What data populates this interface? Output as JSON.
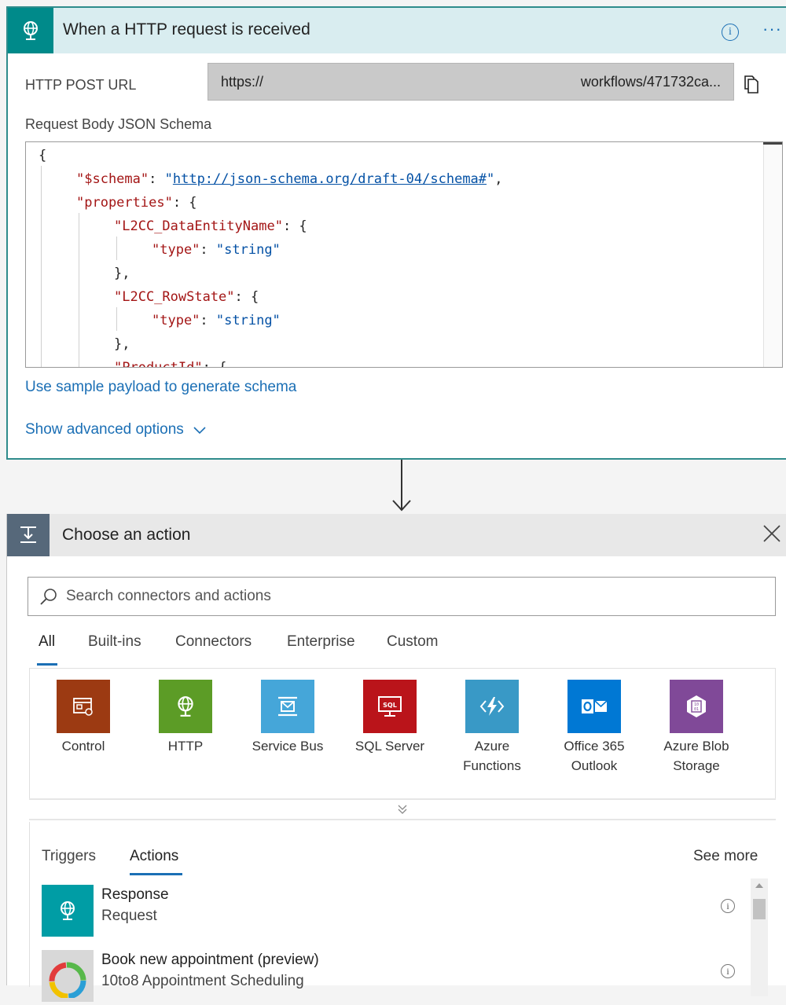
{
  "colors": {
    "trigger_accent": "#008a8a",
    "link": "#1b6fb5",
    "action_header_icon": "#56687a"
  },
  "trigger": {
    "title": "When a HTTP request is received",
    "info_icon": "i",
    "more_icon": "···",
    "http_post_url_label": "HTTP POST URL",
    "url_start": "https://",
    "url_end": "workflows/471732ca...",
    "schema_label": "Request Body JSON Schema",
    "schema_lines": {
      "l0": "{",
      "l1_key": "\"$schema\"",
      "l1_colon": ": ",
      "l1_q1": "\"",
      "l1_url": "http://json-schema.org/draft-04/schema#",
      "l1_q2": "\"",
      "l1_comma": ",",
      "l2_key": "\"properties\"",
      "l2_rest": ": {",
      "l3_key": "\"L2CC_DataEntityName\"",
      "l3_rest": ": {",
      "l4_key": "\"type\"",
      "l4_colon": ": ",
      "l4_val": "\"string\"",
      "l5": "},",
      "l6_key": "\"L2CC_RowState\"",
      "l6_rest": ": {",
      "l7_key": "\"type\"",
      "l7_colon": ": ",
      "l7_val": "\"string\"",
      "l8": "},",
      "l9_key": "\"ProductId\"",
      "l9_rest": ": {"
    },
    "sample_payload_link": "Use sample payload to generate schema",
    "advanced_options_link": "Show advanced options"
  },
  "action_picker": {
    "title": "Choose an action",
    "search_placeholder": "Search connectors and actions",
    "tabs": [
      "All",
      "Built-ins",
      "Connectors",
      "Enterprise",
      "Custom"
    ],
    "active_tab": "All",
    "connectors": [
      {
        "line1": "Control",
        "line2": "",
        "icon": "control-icon",
        "color": "#9c3a12"
      },
      {
        "line1": "HTTP",
        "line2": "",
        "icon": "globe-icon",
        "color": "#5c9c26"
      },
      {
        "line1": "Service Bus",
        "line2": "",
        "icon": "service-bus-icon",
        "color": "#45a6d9"
      },
      {
        "line1": "SQL Server",
        "line2": "",
        "icon": "sql-icon",
        "color": "#ba141a"
      },
      {
        "line1": "Azure",
        "line2": "Functions",
        "icon": "lightning-icon",
        "color": "#3999c6"
      },
      {
        "line1": "Office 365",
        "line2": "Outlook",
        "icon": "outlook-icon",
        "color": "#0078d4"
      },
      {
        "line1": "Azure Blob",
        "line2": "Storage",
        "icon": "blob-icon",
        "color": "#804998"
      }
    ],
    "subtabs": [
      "Triggers",
      "Actions"
    ],
    "active_subtab": "Actions",
    "see_more": "See more",
    "items": [
      {
        "title": "Response",
        "subtitle": "Request",
        "icon": "globe-icon",
        "color": "#009da5"
      },
      {
        "title": "Book new appointment (preview)",
        "subtitle": "10to8 Appointment Scheduling",
        "icon": "ring-icon",
        "color": "#d8d8d8"
      }
    ]
  }
}
